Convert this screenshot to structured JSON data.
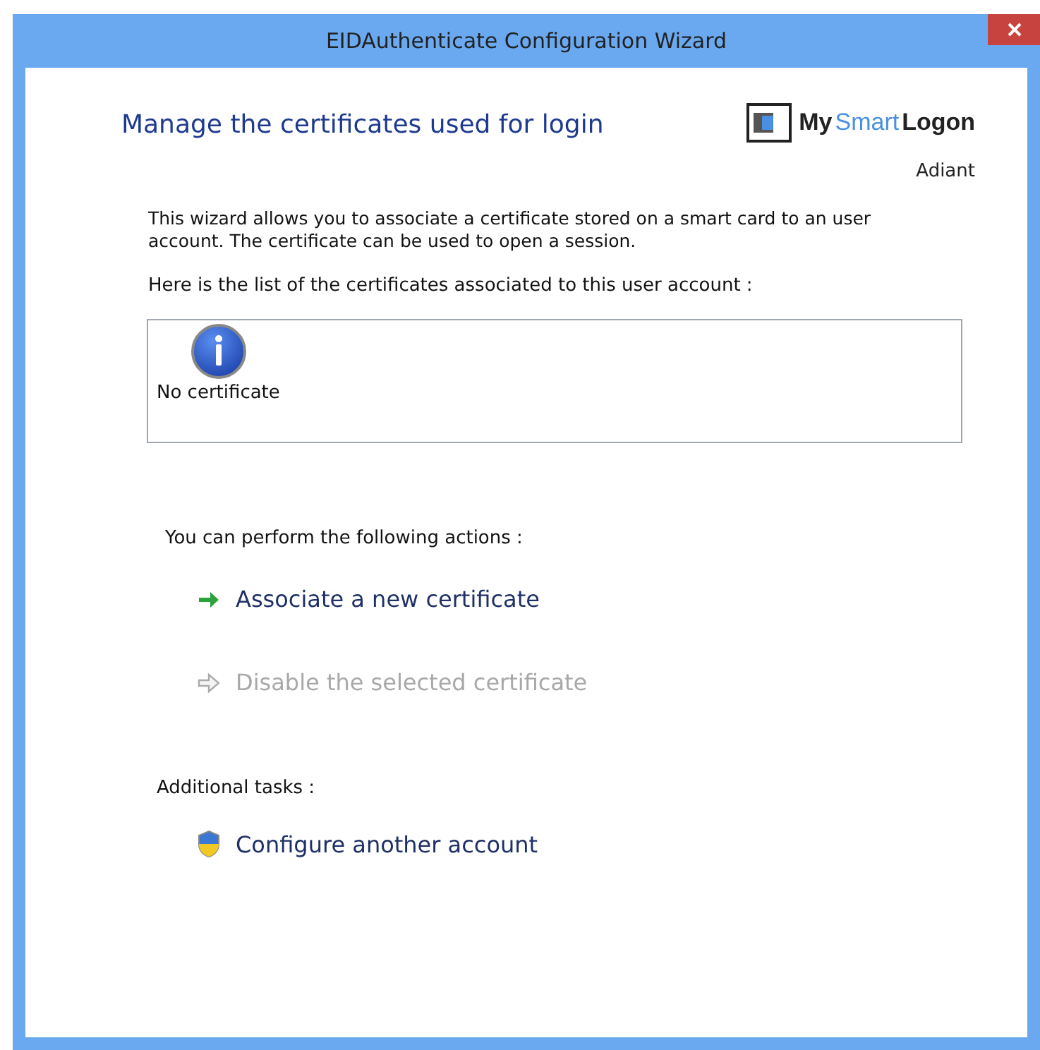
{
  "window": {
    "title": "EIDAuthenticate Configuration Wizard"
  },
  "heading": "Manage the certificates used for login",
  "logo": {
    "segments": [
      {
        "text": "My",
        "kind": "plain"
      },
      {
        "text": "Smart",
        "kind": "accent"
      },
      {
        "text": "Logon",
        "kind": "plain"
      }
    ],
    "caption": "Adiant"
  },
  "intro": "This wizard allows you to associate a certificate stored on a smart card to an user account. The certificate can be used to open a session.",
  "list_label": "Here is the list of the certificates associated to this user account :",
  "certificates": [
    {
      "label": "No certificate",
      "kind": "info"
    }
  ],
  "actions_label": "You can perform the following actions :",
  "actions": [
    {
      "label": "Associate a new certificate",
      "kind": "arrow",
      "disabled": false
    },
    {
      "label": "Disable the selected certificate",
      "kind": "arrow",
      "disabled": true
    }
  ],
  "tasks_label": "Additional tasks :",
  "tasks": [
    {
      "label": "Configure another account",
      "kind": "shield",
      "disabled": false
    }
  ]
}
